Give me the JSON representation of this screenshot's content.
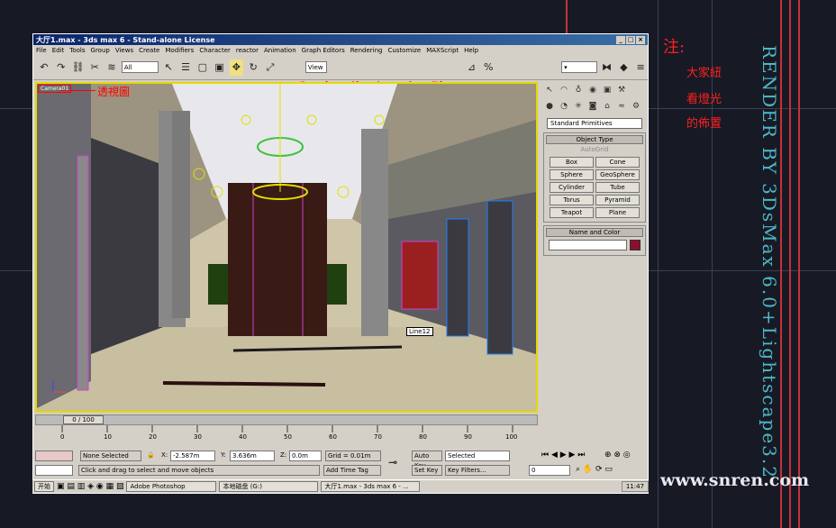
{
  "window": {
    "title": "大厅1.max - 3ds max 6 - Stand-alone License",
    "controls": [
      "_",
      "□",
      "×"
    ]
  },
  "menu": [
    "File",
    "Edit",
    "Tools",
    "Group",
    "Views",
    "Create",
    "Modifiers",
    "Character",
    "reactor",
    "Animation",
    "Graph Editors",
    "Rendering",
    "Customize",
    "MAXScript",
    "Help"
  ],
  "toolbar": {
    "selection_filter": "All",
    "view_combo": "View",
    "overlay_title": "爱中璇辉專貼"
  },
  "viewport": {
    "label": "Camera01",
    "object_tag": "Line12"
  },
  "command_panel": {
    "dropdown": "Standard Primitives",
    "object_type_title": "Object Type",
    "autogrid": "AutoGrid",
    "objects": [
      "Box",
      "Cone",
      "Sphere",
      "GeoSphere",
      "Cylinder",
      "Tube",
      "Torus",
      "Pyramid",
      "Teapot",
      "Plane"
    ],
    "name_color_title": "Name and Color",
    "swatch_color": "#8a1030"
  },
  "timeline": {
    "slider": "0 / 100",
    "ticks": [
      "0",
      "10",
      "20",
      "30",
      "40",
      "50",
      "60",
      "70",
      "80",
      "90",
      "100"
    ]
  },
  "status": {
    "selection": "None Selected",
    "x_label": "X:",
    "x": "-2.587m",
    "y_label": "Y:",
    "y": "3.636m",
    "z_label": "Z:",
    "z": "0.0m",
    "grid": "Grid = 0.01m",
    "auto_key": "Auto Key",
    "selected": "Selected",
    "set_key": "Set Key",
    "key_filters": "Key Filters...",
    "frame": "0",
    "prompt": "Click and drag to select and move objects",
    "add_time_tag": "Add Time Tag"
  },
  "taskbar": {
    "start": "开始",
    "items": [
      "Adobe Photoshop",
      "本地磁盘 (G:)",
      "大厅1.max - 3ds max 6 - ..."
    ],
    "clock": "11:47"
  },
  "annotations": {
    "callout": "透視圖",
    "note_title": "注:",
    "notes": [
      "大家紐",
      "看燈光",
      "的佈置"
    ],
    "vertical": "RENDER BY 3DsMax 6.0+Lightscape3.2",
    "site": "www.snren.com"
  }
}
